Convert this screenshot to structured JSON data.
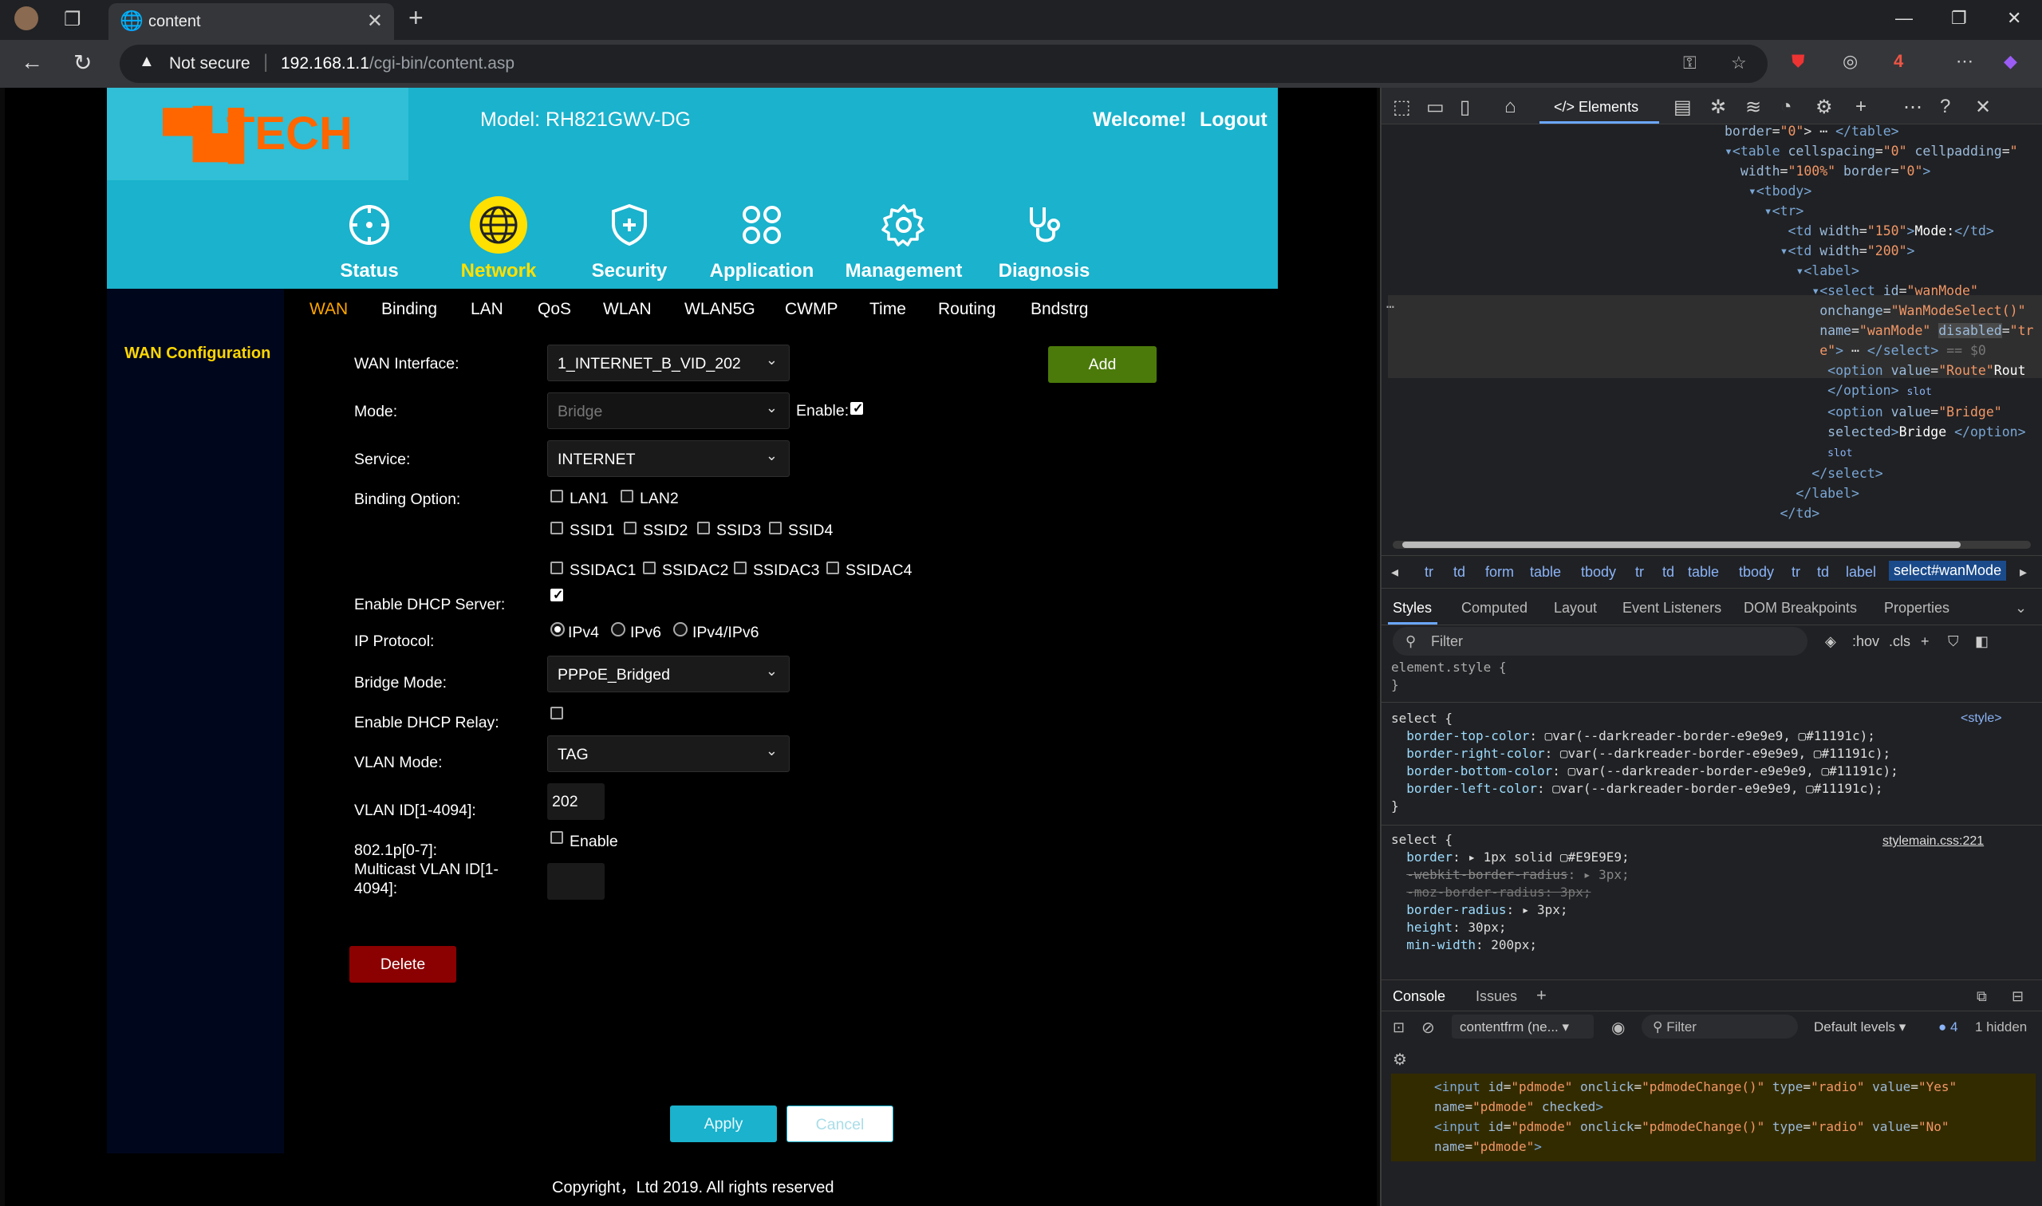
{
  "browser": {
    "tab_title": "content",
    "not_secure_label": "Not secure",
    "url_host": "192.168.1.1",
    "url_path": "/cgi-bin/content.asp",
    "ext_badge": "4"
  },
  "router": {
    "logo_text": "TECH",
    "model": "Model: RH821GWV-DG",
    "welcome": "Welcome!",
    "logout": "Logout",
    "main_nav": [
      {
        "label": "Status",
        "icon": "status-icon"
      },
      {
        "label": "Network",
        "icon": "globe-icon",
        "active": true
      },
      {
        "label": "Security",
        "icon": "shield-plus-icon"
      },
      {
        "label": "Application",
        "icon": "apps-icon"
      },
      {
        "label": "Management",
        "icon": "gear-icon"
      },
      {
        "label": "Diagnosis",
        "icon": "stethoscope-icon"
      }
    ],
    "sub_nav": [
      "WAN",
      "Binding",
      "LAN",
      "QoS",
      "WLAN",
      "WLAN5G",
      "CWMP",
      "Time",
      "Routing",
      "Bndstrg"
    ],
    "sub_nav_active": "WAN",
    "sidebar_title": "WAN Configuration",
    "form": {
      "wan_interface_label": "WAN Interface:",
      "wan_interface_value": "1_INTERNET_B_VID_202",
      "add_button": "Add",
      "mode_label": "Mode:",
      "mode_value": "Bridge",
      "enable_label": "Enable:",
      "service_label": "Service:",
      "service_value": "INTERNET",
      "binding_label": "Binding Option:",
      "binding_options": [
        "LAN1",
        "LAN2",
        "SSID1",
        "SSID2",
        "SSID3",
        "SSID4",
        "SSIDAC1",
        "SSIDAC2",
        "SSIDAC3",
        "SSIDAC4"
      ],
      "dhcp_server_label": "Enable DHCP Server:",
      "ip_protocol_label": "IP Protocol:",
      "ip_protocol_options": [
        "IPv4",
        "IPv6",
        "IPv4/IPv6"
      ],
      "ip_protocol_selected": "IPv4",
      "bridge_mode_label": "Bridge Mode:",
      "bridge_mode_value": "PPPoE_Bridged",
      "dhcp_relay_label": "Enable DHCP Relay:",
      "vlan_mode_label": "VLAN Mode:",
      "vlan_mode_value": "TAG",
      "vlan_id_label": "VLAN ID[1-4094]:",
      "vlan_id_value": "202",
      "dot1p_label": "802.1p[0-7]:",
      "dot1p_enable": "Enable",
      "mcast_label_1": "Multicast VLAN ID[1-",
      "mcast_label_2": "4094]:",
      "mcast_value": "",
      "delete_button": "Delete",
      "apply_button": "Apply",
      "cancel_button": "Cancel"
    },
    "copyright": "Copyright，Ltd 2019. All rights reserved"
  },
  "devtools": {
    "elements_tab": "Elements",
    "breadcrumbs": [
      "tr",
      "td",
      "form",
      "table",
      "tbody",
      "tr",
      "td",
      "table",
      "tbody",
      "tr",
      "td",
      "label",
      "select#wanMode"
    ],
    "panel_tabs": [
      "Styles",
      "Computed",
      "Layout",
      "Event Listeners",
      "DOM Breakpoints",
      "Properties"
    ],
    "filter_placeholder": "Filter",
    "hov": ":hov",
    "cls": ".cls",
    "console_tabs": [
      "Console",
      "Issues"
    ],
    "context": "contentfrm (ne...",
    "default_levels": "Default levels",
    "msg_count": "4",
    "hidden": "1 hidden",
    "style_source_1": "<style>",
    "style_source_2": "stylemain.css:221"
  },
  "colors": {
    "banner": "#1ab2cc",
    "active_nav": "#ffe000",
    "add_button": "#4b7a0a",
    "delete_button": "#8b0000",
    "apply_button": "#1ab2cc",
    "sidebar": "#00071c"
  }
}
